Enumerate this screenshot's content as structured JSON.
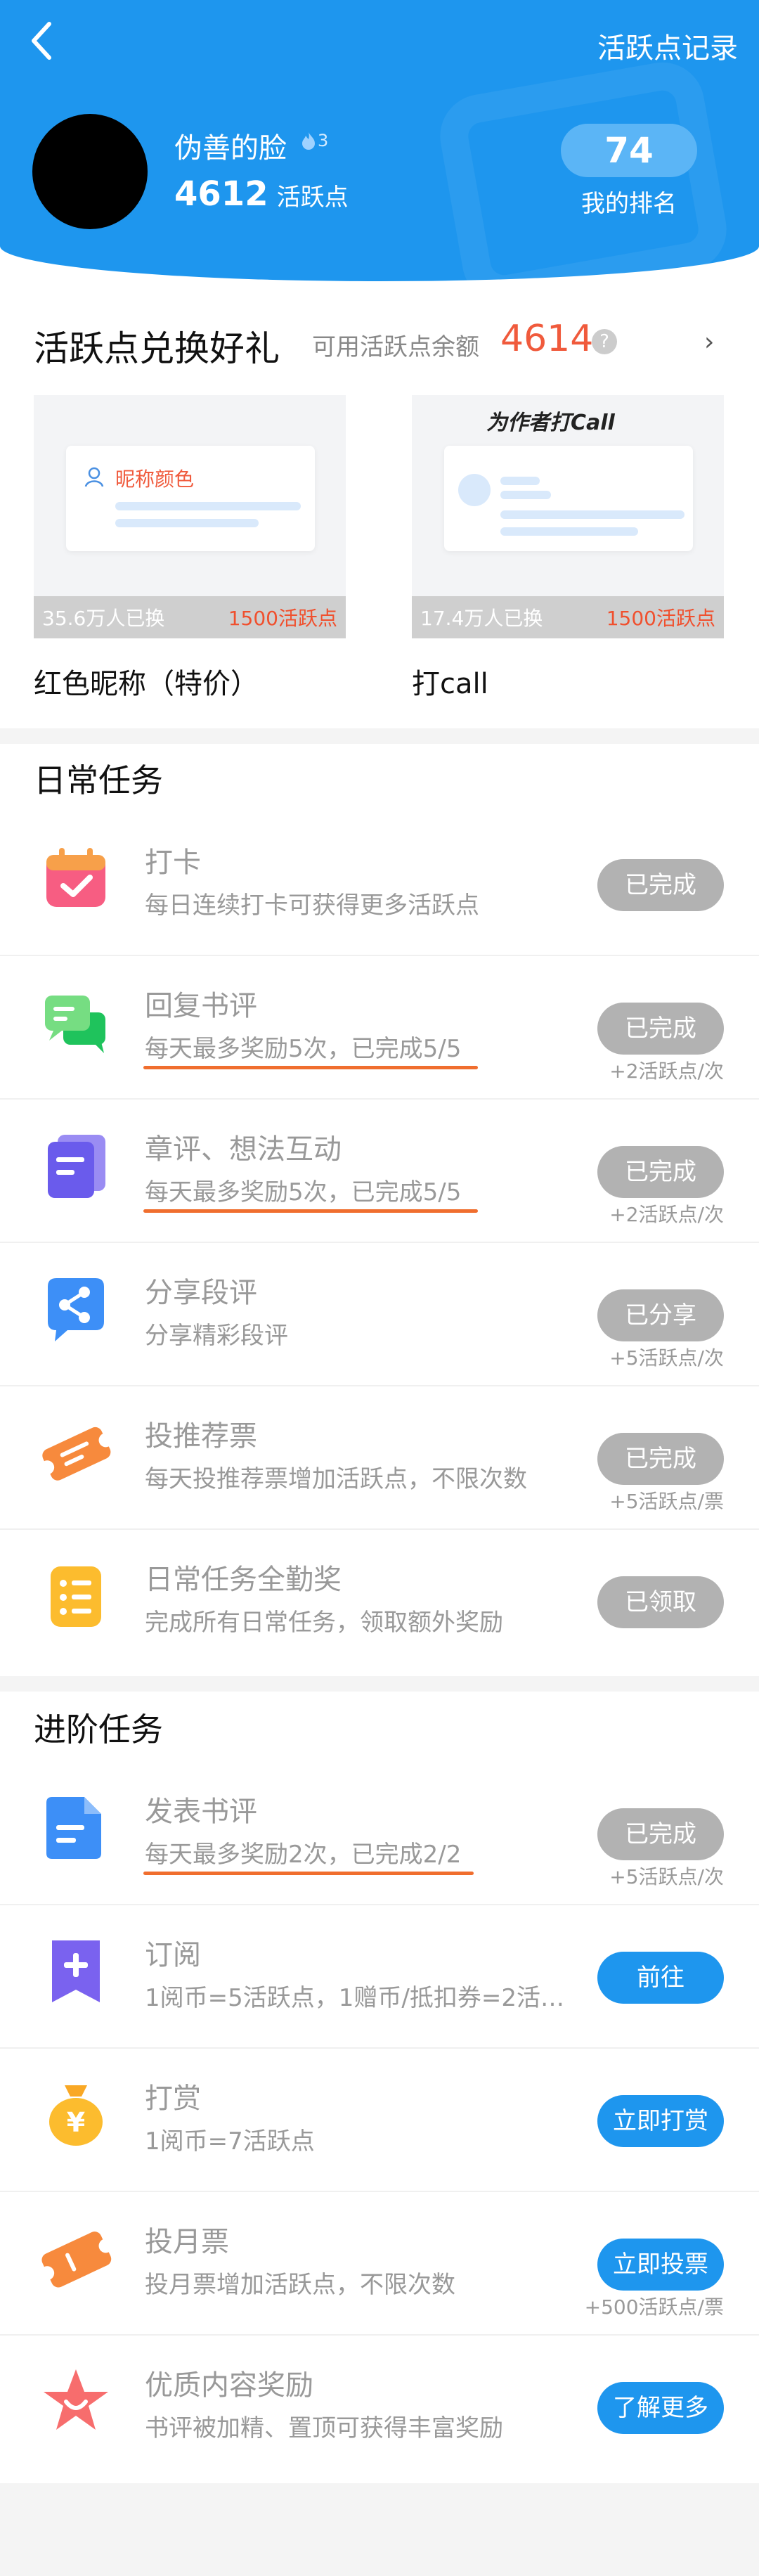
{
  "header": {
    "record_label": "活跃点记录"
  },
  "user": {
    "name": "伪善的脸",
    "level": "3",
    "points": "4612",
    "points_unit": "活跃点",
    "rank": "74",
    "rank_label": "我的排名"
  },
  "exchange": {
    "title": "活跃点兑换好礼",
    "balance_label": "可用活跃点余额",
    "balance": "4614",
    "help": "?",
    "arrow": "›",
    "gifts": [
      {
        "card_text": "昵称颜色",
        "exchanged": "35.6万人已换",
        "price": "1500活跃点",
        "name": "红色昵称（特价）"
      },
      {
        "card_text": "为作者打Call",
        "exchanged": "17.4万人已换",
        "price": "1500活跃点",
        "name": "打call"
      }
    ]
  },
  "daily": {
    "title": "日常任务",
    "tasks": [
      {
        "title": "打卡",
        "desc": "每日连续打卡可获得更多活跃点",
        "button": "已完成",
        "reward": ""
      },
      {
        "title": "回复书评",
        "desc": "每天最多奖励5次，已完成5/5",
        "button": "已完成",
        "reward": "+2活跃点/次"
      },
      {
        "title": "章评、想法互动",
        "desc": "每天最多奖励5次，已完成5/5",
        "button": "已完成",
        "reward": "+2活跃点/次"
      },
      {
        "title": "分享段评",
        "desc": "分享精彩段评",
        "button": "已分享",
        "reward": "+5活跃点/次"
      },
      {
        "title": "投推荐票",
        "desc": "每天投推荐票增加活跃点，不限次数",
        "button": "已完成",
        "reward": "+5活跃点/票"
      },
      {
        "title": "日常任务全勤奖",
        "desc": "完成所有日常任务，领取额外奖励",
        "button": "已领取",
        "reward": ""
      }
    ]
  },
  "advanced": {
    "title": "进阶任务",
    "tasks": [
      {
        "title": "发表书评",
        "desc": "每天最多奖励2次，已完成2/2",
        "button": "已完成",
        "reward": "+5活跃点/次"
      },
      {
        "title": "订阅",
        "desc": "1阅币=5活跃点，1赠币/抵扣券=2活…",
        "button": "前往",
        "reward": ""
      },
      {
        "title": "打赏",
        "desc": "1阅币=7活跃点",
        "button": "立即打赏",
        "reward": ""
      },
      {
        "title": "投月票",
        "desc": "投月票增加活跃点，不限次数",
        "button": "立即投票",
        "reward": "+500活跃点/票"
      },
      {
        "title": "优质内容奖励",
        "desc": "书评被加精、置顶可获得丰富奖励",
        "button": "了解更多",
        "reward": ""
      }
    ]
  },
  "colors": {
    "brand": "#1e96ee",
    "accent": "#f05a3c",
    "done_button": "#b2b2b2"
  }
}
